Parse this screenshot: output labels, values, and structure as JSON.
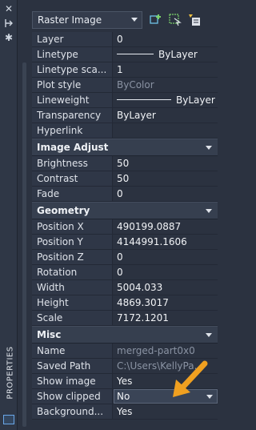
{
  "side": {
    "title": "PROPERTIES",
    "icons": [
      "close-icon",
      "pin-icon",
      "gear-icon"
    ]
  },
  "selector": {
    "value": "Raster Image"
  },
  "general": {
    "rows": [
      {
        "label": "Layer",
        "value": "0"
      },
      {
        "label": "Linetype",
        "value": "ByLayer"
      },
      {
        "label": "Linetype sca...",
        "value": "1"
      },
      {
        "label": "Plot style",
        "value": "ByColor"
      },
      {
        "label": "Lineweight",
        "value": "ByLayer"
      },
      {
        "label": "Transparency",
        "value": "ByLayer"
      },
      {
        "label": "Hyperlink",
        "value": ""
      }
    ]
  },
  "image_adjust": {
    "title": "Image Adjust",
    "rows": [
      {
        "label": "Brightness",
        "value": "50"
      },
      {
        "label": "Contrast",
        "value": "50"
      },
      {
        "label": "Fade",
        "value": "0"
      }
    ]
  },
  "geometry": {
    "title": "Geometry",
    "rows": [
      {
        "label": "Position X",
        "value": "490199.0887"
      },
      {
        "label": "Position Y",
        "value": "4144991.1606"
      },
      {
        "label": "Position Z",
        "value": "0"
      },
      {
        "label": "Rotation",
        "value": "0"
      },
      {
        "label": "Width",
        "value": "5004.033"
      },
      {
        "label": "Height",
        "value": "4869.3017"
      },
      {
        "label": "Scale",
        "value": "7172.1201"
      }
    ]
  },
  "misc": {
    "title": "Misc",
    "rows": [
      {
        "label": "Name",
        "value": "merged-part0x0"
      },
      {
        "label": "Saved Path",
        "value": "C:\\Users\\KellyPa..."
      },
      {
        "label": "Show image",
        "value": "Yes"
      },
      {
        "label": "Show clipped",
        "value": "No"
      },
      {
        "label": "Background...",
        "value": "Yes"
      }
    ]
  },
  "colors": {
    "accent_arrow": "#f0a020",
    "panel_bg": "#2b3240"
  }
}
